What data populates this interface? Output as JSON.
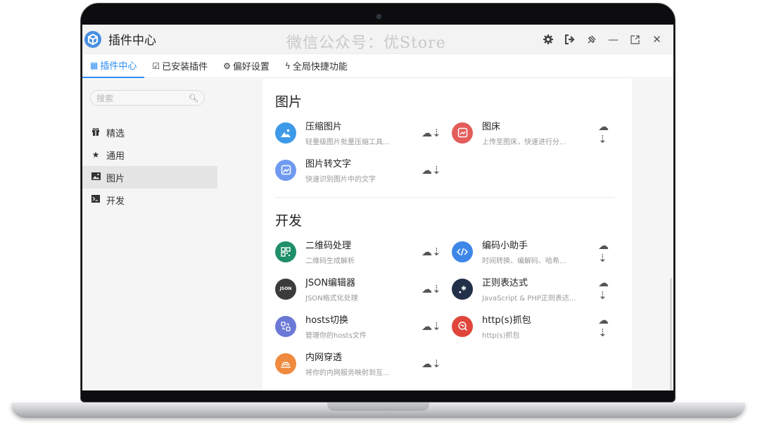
{
  "app": {
    "title": "插件中心",
    "watermark": "微信公众号：优Store"
  },
  "tabs": [
    {
      "label": "插件中心",
      "icon": "grid-icon"
    },
    {
      "label": "已安装插件",
      "icon": "checkbox-icon"
    },
    {
      "label": "偏好设置",
      "icon": "gear-icon"
    },
    {
      "label": "全局快捷功能",
      "icon": "lightning-icon"
    }
  ],
  "search": {
    "placeholder": "搜索"
  },
  "sidebar": {
    "items": [
      {
        "label": "精选",
        "icon": "gift-icon"
      },
      {
        "label": "通用",
        "icon": "star-icon"
      },
      {
        "label": "图片",
        "icon": "image-icon"
      },
      {
        "label": "开发",
        "icon": "terminal-icon"
      }
    ]
  },
  "sections": [
    {
      "title": "图片",
      "items": [
        {
          "name": "压缩图片",
          "desc": "轻量级图片批量压缩工具...",
          "icon": "compress-image-icon",
          "color": "#3d9ae8"
        },
        {
          "name": "图床",
          "desc": "上传至图床，快速进行分...",
          "icon": "image-upload-icon",
          "color": "#e35d5b"
        },
        {
          "name": "图片转文字",
          "desc": "快速识别图片中的文字",
          "icon": "ocr-icon",
          "color": "#6f9af0"
        }
      ]
    },
    {
      "title": "开发",
      "items": [
        {
          "name": "二维码处理",
          "desc": "二维码生成解析",
          "icon": "qrcode-icon",
          "color": "#1f8f6a"
        },
        {
          "name": "编码小助手",
          "desc": "时间转换、编解码、哈希...",
          "icon": "code-icon",
          "color": "#3e86e8"
        },
        {
          "name": "JSON编辑器",
          "desc": "JSON格式化处理",
          "icon": "json-icon",
          "color": "#3b3b3b",
          "badge": "JSON"
        },
        {
          "name": "正则表达式",
          "desc": "JavaScript & PHP正则表达...",
          "icon": "regex-icon",
          "color": "#223049"
        },
        {
          "name": "hosts切换",
          "desc": "管理你的hosts文件",
          "icon": "hosts-icon",
          "color": "#6a78d6"
        },
        {
          "name": "http(s)抓包",
          "desc": "http(s)抓包",
          "icon": "capture-icon",
          "color": "#e0453b"
        },
        {
          "name": "内网穿透",
          "desc": "将你的内网服务映射到互...",
          "icon": "tunnel-icon",
          "color": "#ef8a3e"
        }
      ]
    }
  ],
  "colors": {
    "accent": "#2d8cf0",
    "sidebar_bg": "#f5f5f5"
  }
}
